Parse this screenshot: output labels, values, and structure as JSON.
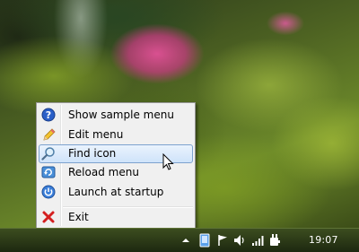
{
  "menu": {
    "items": [
      {
        "label": "Show sample menu",
        "icon": "help-icon"
      },
      {
        "label": "Edit menu",
        "icon": "pencil-icon"
      },
      {
        "label": "Find icon",
        "icon": "magnifier-icon",
        "highlighted": true
      },
      {
        "label": "Reload menu",
        "icon": "reload-icon"
      },
      {
        "label": "Launch at startup",
        "icon": "power-icon"
      },
      {
        "label": "Exit",
        "icon": "close-icon"
      }
    ]
  },
  "taskbar": {
    "clock": "19:07",
    "tray_icons": [
      "show-hidden-icons-arrow",
      "app-tray-icon",
      "flag-icon",
      "volume-icon",
      "network-signal-icon",
      "power-plug-icon"
    ]
  },
  "colors": {
    "menu_background": "#f0f0f0",
    "highlight_border": "#7da2ce",
    "highlight_fill": "#cfe3fa",
    "taskbar": "#2b3a17"
  }
}
